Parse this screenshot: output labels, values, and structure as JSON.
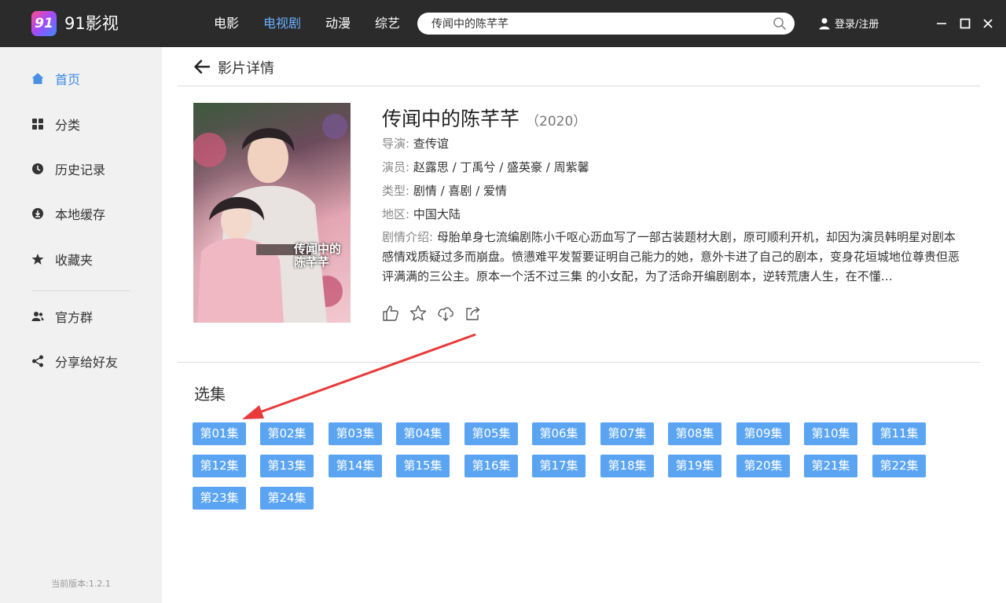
{
  "app": {
    "logo_text": "91",
    "name": "91影视"
  },
  "nav": [
    {
      "label": "电影",
      "active": false
    },
    {
      "label": "电视剧",
      "active": true
    },
    {
      "label": "动漫",
      "active": false
    },
    {
      "label": "综艺",
      "active": false
    }
  ],
  "search": {
    "value": "传闻中的陈芊芊",
    "icon": "search-icon"
  },
  "login": {
    "label": "登录/注册",
    "icon": "user-icon"
  },
  "window_controls": [
    "minimize-icon",
    "maximize-icon",
    "close-icon"
  ],
  "sidebar": {
    "items": [
      {
        "label": "首页",
        "icon": "home-icon",
        "active": true
      },
      {
        "label": "分类",
        "icon": "grid-icon",
        "active": false
      },
      {
        "label": "历史记录",
        "icon": "clock-icon",
        "active": false
      },
      {
        "label": "本地缓存",
        "icon": "download-icon",
        "active": false
      },
      {
        "label": "收藏夹",
        "icon": "star-icon",
        "active": false
      },
      {
        "label": "官方群",
        "icon": "group-icon",
        "active": false
      },
      {
        "label": "分享给好友",
        "icon": "share-icon",
        "active": false
      }
    ],
    "version": "当前版本:1.2.1"
  },
  "page": {
    "title": "影片详情",
    "back_icon": "back-arrow-icon"
  },
  "movie": {
    "title": "传闻中的陈芊芊",
    "year": "（2020）",
    "director_label": "导演:",
    "director": "查传谊",
    "cast_label": "演员:",
    "cast": "赵露思 / 丁禹兮 / 盛英豪 / 周紫馨",
    "genre_label": "类型:",
    "genre": "剧情 / 喜剧 / 爱情",
    "region_label": "地区:",
    "region": "中国大陆",
    "synopsis_label": "剧情介绍:",
    "synopsis": "母胎单身七流编剧陈小千呕心沥血写了一部古装题材大剧，原可顺利开机，却因为演员韩明星对剧本感情戏质疑过多而崩盘。愤懑难平发誓要证明自己能力的她，意外卡进了自己的剧本，变身花垣城地位尊贵但恶评满满的三公主。原本一个活不过三集 的小女配，为了活命开编剧剧本，逆转荒唐人生，在不懂…",
    "poster_text": "传闻中的陈芊芊",
    "actions": [
      "like-icon",
      "star-icon",
      "cloud-download-icon",
      "share-icon"
    ]
  },
  "episodes": {
    "title": "选集",
    "list": [
      "第01集",
      "第02集",
      "第03集",
      "第04集",
      "第05集",
      "第06集",
      "第07集",
      "第08集",
      "第09集",
      "第10集",
      "第11集",
      "第12集",
      "第13集",
      "第14集",
      "第15集",
      "第16集",
      "第17集",
      "第18集",
      "第19集",
      "第20集",
      "第21集",
      "第22集",
      "第23集",
      "第24集"
    ]
  },
  "colors": {
    "accent": "#5aa4f2",
    "active_nav": "#6ab0ff",
    "annotation_arrow": "#e83a3a"
  }
}
